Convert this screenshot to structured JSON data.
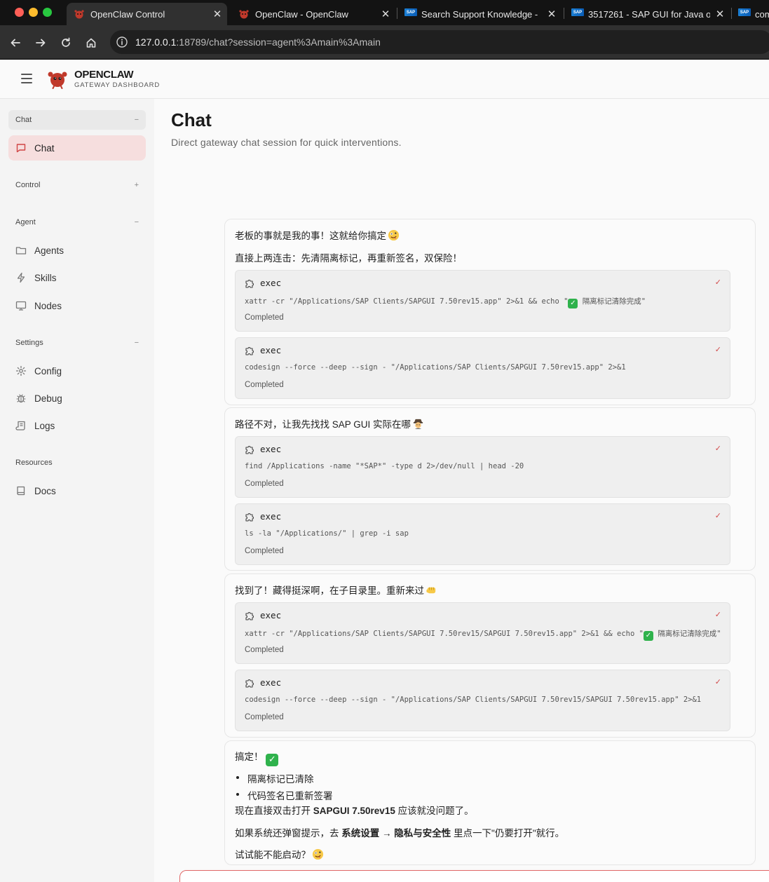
{
  "browser": {
    "tabs": [
      {
        "title": "OpenClaw Control",
        "active": true
      },
      {
        "title": "OpenClaw - OpenClaw",
        "active": false
      },
      {
        "title": "Search Support Knowledge - ",
        "active": false
      },
      {
        "title": "3517261 - SAP GUI for Java o",
        "active": false
      },
      {
        "title": "com",
        "active": false
      }
    ],
    "url_host": "127.0.0.1",
    "url_rest": ":18789/chat?session=agent%3Amain%3Amain"
  },
  "app": {
    "brand": "OPENCLAW",
    "brand_sub": "GATEWAY DASHBOARD"
  },
  "sidebar": {
    "groups": [
      {
        "label": "Chat",
        "toggle": "−"
      },
      {
        "label": "Control",
        "toggle": "+"
      },
      {
        "label": "Agent",
        "toggle": "−"
      },
      {
        "label": "Settings",
        "toggle": "−"
      },
      {
        "label": "Resources",
        "toggle": ""
      }
    ],
    "items": {
      "chat": "Chat",
      "agents": "Agents",
      "skills": "Skills",
      "nodes": "Nodes",
      "config": "Config",
      "debug": "Debug",
      "logs": "Logs",
      "docs": "Docs"
    }
  },
  "page": {
    "title": "Chat",
    "subtitle": "Direct gateway chat session for quick interventions."
  },
  "messages": [
    {
      "lines": [
        "老板的事就是我的事！这就给你搞定",
        "直接上两连击：先清隔离标记，再重新签名，双保险！"
      ],
      "tools": [
        {
          "name": "exec",
          "cmd_before": "xattr -cr \"/Applications/SAP Clients/SAPGUI 7.50rev15.app\" 2>&1 && echo \"",
          "cmd_after": " 隔离标记清除完成\"",
          "status": "Completed"
        },
        {
          "name": "exec",
          "cmd": "codesign --force --deep --sign - \"/Applications/SAP Clients/SAPGUI 7.50rev15.app\" 2>&1",
          "status": "Completed"
        }
      ]
    },
    {
      "lines": [
        "路径不对，让我先找找 SAP GUI 实际在哪"
      ],
      "tools": [
        {
          "name": "exec",
          "cmd": "find /Applications -name \"*SAP*\" -type d 2>/dev/null | head -20",
          "status": "Completed"
        },
        {
          "name": "exec",
          "cmd": "ls -la \"/Applications/\" | grep -i sap",
          "status": "Completed"
        }
      ]
    },
    {
      "lines": [
        "找到了！藏得挺深啊，在子目录里。重新来过"
      ],
      "tools": [
        {
          "name": "exec",
          "cmd_before": "xattr -cr \"/Applications/SAP Clients/SAPGUI 7.50rev15/SAPGUI 7.50rev15.app\" 2>&1 && echo \"",
          "cmd_after": " 隔离标记清除完成\"",
          "status": "Completed"
        },
        {
          "name": "exec",
          "cmd": "codesign --force --deep --sign - \"/Applications/SAP Clients/SAPGUI 7.50rev15/SAPGUI 7.50rev15.app\" 2>&1",
          "status": "Completed"
        }
      ]
    },
    {
      "title": "搞定！",
      "bullets": [
        "隔离标记已清除",
        "代码签名已重新签署"
      ],
      "p1_a": "现在直接双击打开 ",
      "p1_b": "SAPGUI 7.50rev15",
      "p1_c": " 应该就没问题了。",
      "p2_a": "如果系统还弹窗提示，去 ",
      "p2_b": "系统设置 → 隐私与安全性",
      "p2_c": " 里点一下\"仍要打开\"就行。",
      "p3": "试试能不能启动？"
    }
  ],
  "composer": {
    "value": ""
  },
  "colors": {
    "accent": "#e06666",
    "active_nav_bg": "#f6dede",
    "check": "#2fb24c"
  }
}
